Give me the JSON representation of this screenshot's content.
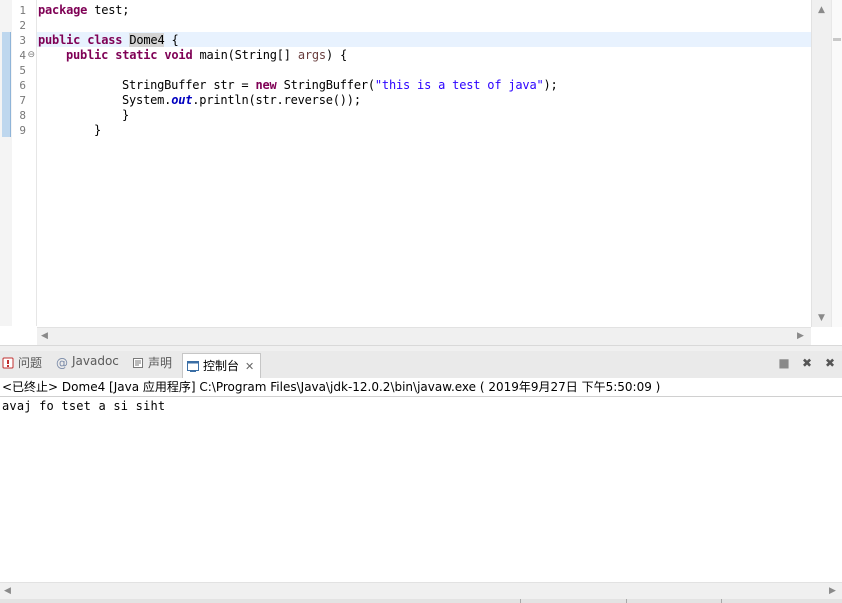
{
  "editor": {
    "line_numbers": [
      "1",
      "2",
      "3",
      "4",
      "5",
      "6",
      "7",
      "8",
      "9"
    ],
    "fold_marker": "⊖",
    "code": {
      "l1_kw": "package",
      "l1_rest": " test;",
      "l3_kw1": "public",
      "l3_kw2": "class",
      "l3_name": "Dome4",
      "l3_rest": " {",
      "l4_kw1": "public",
      "l4_kw2": "static",
      "l4_kw3": "void",
      "l4_mid": " main(String[] ",
      "l4_param": "args",
      "l4_rest": ") {",
      "l6_pre": "StringBuffer str = ",
      "l6_kw": "new",
      "l6_mid": " StringBuffer(",
      "l6_str": "\"this is a test of java\"",
      "l6_rest": ");",
      "l7_pre": "System.",
      "l7_field": "out",
      "l7_rest": ".println(str.reverse());",
      "l8": "}",
      "l9": "}"
    }
  },
  "console_tabs": [
    {
      "label": "问题",
      "icon": "problems-icon"
    },
    {
      "label": "Javadoc",
      "icon": "at-icon"
    },
    {
      "label": "声明",
      "icon": "declaration-icon"
    },
    {
      "label": "控制台",
      "icon": "console-icon",
      "active": true
    }
  ],
  "toolbar": {
    "stop_icon": "■",
    "remove_icon": "✖",
    "remove_all_icon": "✖"
  },
  "console": {
    "header": "<已终止> Dome4 [Java 应用程序] C:\\Program Files\\Java\\jdk-12.0.2\\bin\\javaw.exe ( 2019年9月27日 下午5:50:09 )",
    "output": "avaj fo tset a si siht"
  }
}
